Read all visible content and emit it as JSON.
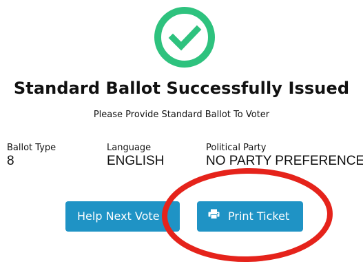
{
  "dialog": {
    "status_icon": "check-circle-icon",
    "title": "Standard Ballot Successfully Issued",
    "subtitle": "Please Provide Standard Ballot To Voter"
  },
  "fields": {
    "ballot_type": {
      "label": "Ballot Type",
      "value": "8"
    },
    "language": {
      "label": "Language",
      "value": "ENGLISH"
    },
    "political_party": {
      "label": "Political Party",
      "value": "NO PARTY PREFERENCE"
    }
  },
  "actions": {
    "help_next_voter_label": "Help Next Vote",
    "print_ticket_label": "Print Ticket",
    "print_icon": "printer-icon"
  },
  "colors": {
    "success_green": "#2ec27e",
    "button_blue": "#1f93c5",
    "annotation_red": "#e5231b"
  }
}
